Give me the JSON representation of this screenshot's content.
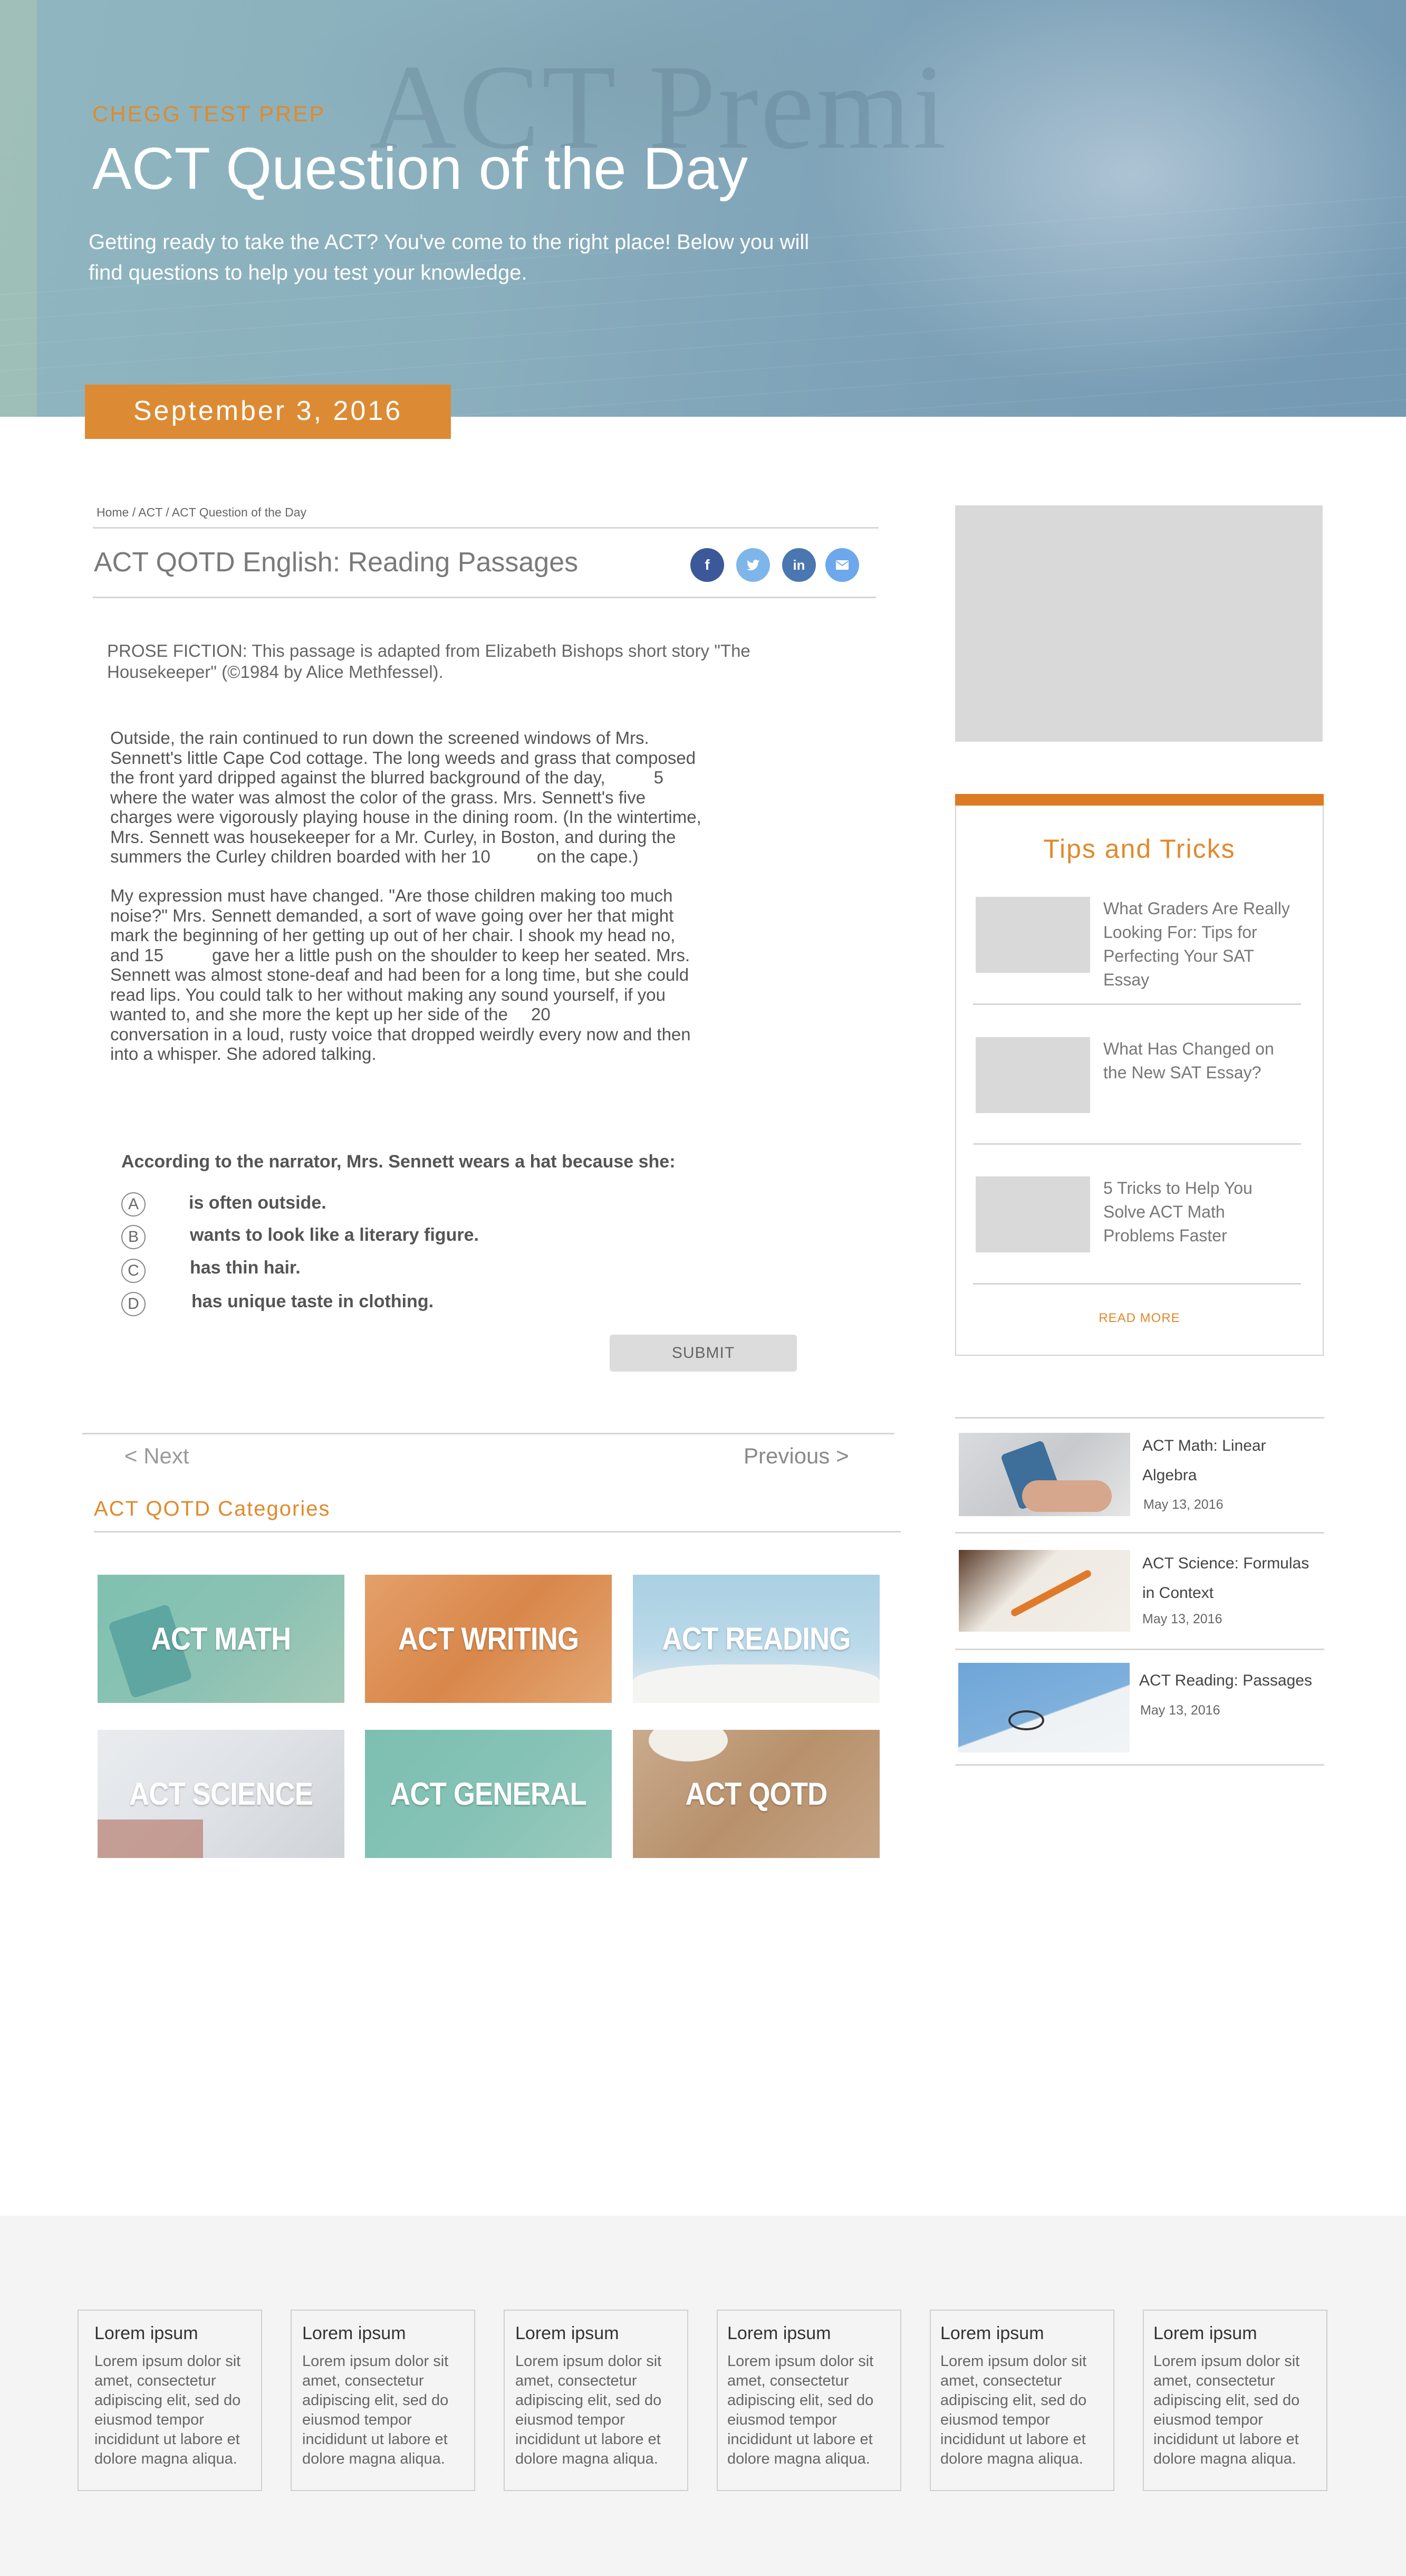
{
  "hero": {
    "brand": "CHEGG TEST PREP",
    "title": "ACT Question of the Day",
    "subtitle": "Getting ready to take the ACT? You've come to the right place! Below you will find questions to help you test your knowledge.",
    "date": "September 3, 2016"
  },
  "breadcrumb": "Home / ACT / ACT Question of the Day",
  "article": {
    "title": "ACT QOTD English: Reading Passages",
    "share": [
      "facebook-icon",
      "twitter-icon",
      "linkedin-icon",
      "email-icon"
    ],
    "intro": "PROSE FICTION: This passage is adapted from Elizabeth Bishops short story \"The Housekeeper\" (©1984 by Alice Methfessel).",
    "paragraph1": [
      "Outside, the rain continued to run down the screened windows of Mrs.",
      "Sennett's little Cape Cod cottage. The long weeds and grass that composed",
      "the front yard dripped against the blurred background of the day,",
      "where the water was almost the color of the grass. Mrs. Sennett's five",
      "charges were vigorously playing house in the dining room. (In the wintertime,",
      "Mrs. Sennett was housekeeper for a Mr. Curley, in Boston, and during the",
      "summers the Curley children boarded with her 10",
      "on the cape.)"
    ],
    "paragraph2": [
      "My expression must have changed. \"Are those children making too much",
      "noise?\" Mrs. Sennett demanded, a sort of wave going over her that might",
      "mark the beginning of her getting up out of her chair. I shook my head no,",
      "and 15",
      "gave her a little push on the shoulder to keep her seated. Mrs.",
      "Sennett was almost stone-deaf and had been for a long time, but she could",
      "read lips. You could talk to her without making any sound yourself, if you",
      "wanted to, and she more the kept up her side of the",
      "conversation in a loud, rusty voice that dropped weirdly every now and then",
      "into a whisper. She adored talking."
    ],
    "line_numbers": [
      "5",
      "20"
    ],
    "question": "According to the narrator, Mrs. Sennett wears a hat because she:",
    "choices": [
      {
        "letter": "A",
        "text": "is often outside."
      },
      {
        "letter": "B",
        "text": "wants to look like a literary figure."
      },
      {
        "letter": "C",
        "text": "has thin hair."
      },
      {
        "letter": "D",
        "text": "has unique taste in clothing."
      }
    ],
    "submit": "SUBMIT"
  },
  "nav": {
    "next": "< Next",
    "previous": "Previous >"
  },
  "categories": {
    "heading": "ACT QOTD Categories",
    "tiles": [
      "ACT MATH",
      "ACT WRITING",
      "ACT  READING",
      "ACT SCIENCE",
      "ACT GENERAL",
      "ACT QOTD"
    ]
  },
  "tips": {
    "title": "Tips and Tricks",
    "items": [
      "What Graders Are Really Looking For: Tips for Perfecting Your SAT Essay",
      "What Has Changed on the New SAT Essay?",
      "5 Tricks to Help You Solve ACT Math Problems Faster"
    ],
    "read_more": "READ MORE"
  },
  "related": [
    {
      "title": "ACT Math: Linear Algebra",
      "date": "May 13, 2016"
    },
    {
      "title": "ACT Science: Formulas in Context",
      "date": "May 13, 2016"
    },
    {
      "title": "ACT Reading: Passages",
      "date": "May 13, 2016"
    }
  ],
  "footer": {
    "cards": [
      {
        "title": "Lorem ipsum",
        "body": "Lorem ipsum dolor sit amet, consectetur adipiscing elit, sed do eiusmod tempor incididunt ut labore et dolore magna aliqua."
      },
      {
        "title": "Lorem ipsum",
        "body": "Lorem ipsum dolor sit amet, consectetur adipiscing elit, sed do eiusmod tempor incididunt ut labore et dolore magna aliqua."
      },
      {
        "title": "Lorem ipsum",
        "body": "Lorem ipsum dolor sit amet, consectetur adipiscing elit, sed do eiusmod tempor incididunt ut labore et dolore magna aliqua."
      },
      {
        "title": "Lorem ipsum",
        "body": "Lorem ipsum dolor sit amet, consectetur adipiscing elit, sed do eiusmod tempor incididunt ut labore et dolore magna aliqua."
      },
      {
        "title": "Lorem ipsum",
        "body": "Lorem ipsum dolor sit amet, consectetur adipiscing elit, sed do eiusmod tempor incididunt ut labore et dolore magna aliqua."
      },
      {
        "title": "Lorem ipsum",
        "body": "Lorem ipsum dolor sit amet, consectetur adipiscing elit, sed do eiusmod tempor incididunt ut labore et dolore magna aliqua."
      }
    ]
  },
  "colors": {
    "accent_orange": "#dc8b34",
    "facebook": "#3b5998",
    "twitter": "#55acee",
    "linkedin": "#0e76a8",
    "email": "#5aa3e8",
    "panel_gray": "#d9d9d9",
    "footer_bg": "#f4f4f4"
  }
}
